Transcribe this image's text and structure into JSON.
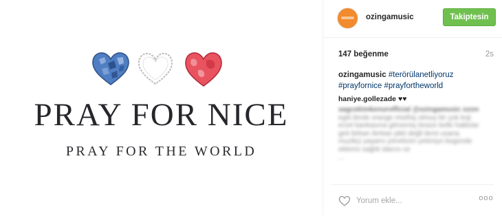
{
  "post": {
    "image": {
      "hearts": [
        {
          "name": "blue-heart-icon",
          "color": "#3f6fb8"
        },
        {
          "name": "white-heart-icon",
          "color": "#d9d9d9"
        },
        {
          "name": "red-heart-icon",
          "color": "#d7354a"
        }
      ],
      "title": "PRAY FOR NICE",
      "subtitle": "PRAY FOR THE WORLD"
    }
  },
  "header": {
    "username": "ozingamusic",
    "follow_label": "Takiptesin",
    "accent_color": "#70c050"
  },
  "meta": {
    "likes": "147 beğenme",
    "time": "2s"
  },
  "caption": {
    "user": "ozingamusic",
    "tags": [
      "#terörülanetliyoruz",
      "#prayfornice",
      "#prayfortheworld"
    ]
  },
  "comments": [
    {
      "user": "haniye.gollezade",
      "text": "♥♥"
    }
  ],
  "blurred_comment_lines": [
    "sagcekimkenurofficial @ozingamusic ozon",
    "egiti ilerde orange misthiş olmuş bir çok koji",
    "erzel bankasına gitmemiş biraze belki hakkılar",
    "geti birkan ilerkan şikti değil ilemi usana",
    "muzikçi yaşamı yöneticim yetimiyo bogünde",
    "eklerini sağlık idarını ce",
    "..."
  ],
  "footer": {
    "comment_placeholder": "Yorum ekle...",
    "more_label": "ooo",
    "heart_icon": "heart-outline-icon",
    "more_icon": "more-options-icon"
  }
}
